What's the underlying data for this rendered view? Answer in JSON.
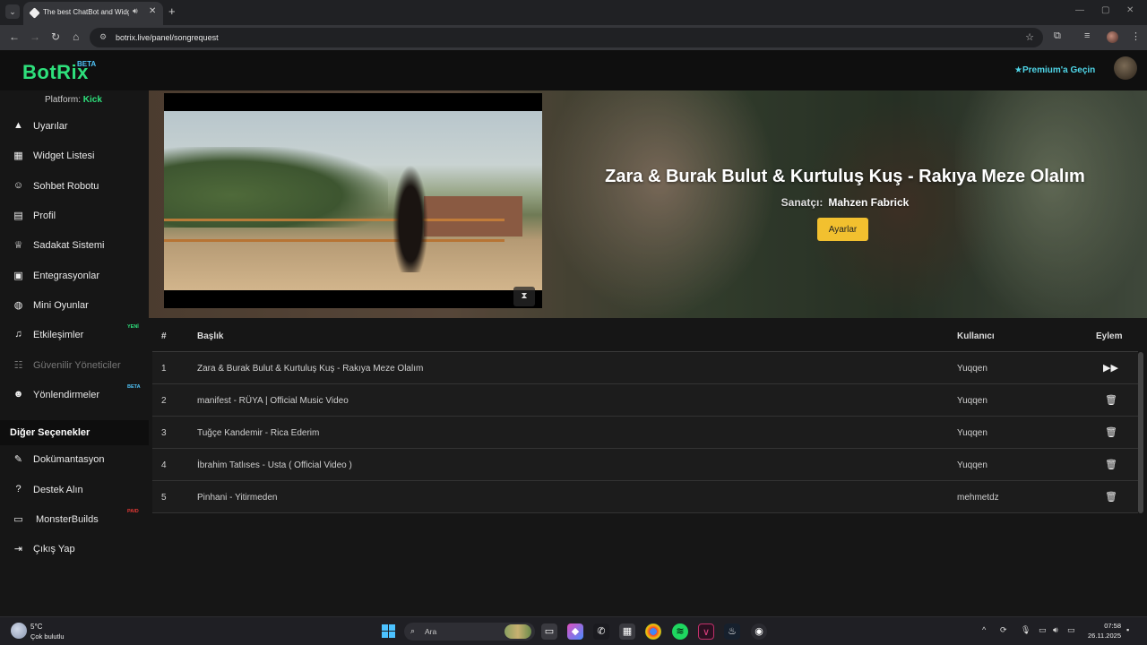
{
  "browser": {
    "tab_title": "The best ChatBot and Widgets",
    "url": "botrix.live/panel/songrequest"
  },
  "header": {
    "logo": "BotRix",
    "logo_badge": "BETA",
    "premium_label": "Premium'a Geçin"
  },
  "sidebar": {
    "platform_label": "Platform:",
    "platform_value": "Kick",
    "items": [
      {
        "label": "Uyarılar",
        "icon": "warning-icon"
      },
      {
        "label": "Widget Listesi",
        "icon": "grid-icon"
      },
      {
        "label": "Sohbet Robotu",
        "icon": "robot-icon"
      },
      {
        "label": "Profil",
        "icon": "id-card-icon"
      },
      {
        "label": "Sadakat Sistemi",
        "icon": "trophy-icon"
      },
      {
        "label": "Entegrasyonlar",
        "icon": "plug-icon"
      },
      {
        "label": "Mini Oyunlar",
        "icon": "gamepad-icon"
      },
      {
        "label": "Etkileşimler",
        "icon": "music-icon",
        "badge": "YENİ",
        "badge_color": "#2ee07c"
      },
      {
        "label": "Güvenilir Yöneticiler",
        "icon": "users-icon",
        "disabled": true
      },
      {
        "label": "Yönlendirmeler",
        "icon": "user-group-icon",
        "badge": "BETA",
        "badge_color": "#4fc3f7"
      }
    ],
    "section_title": "Diğer Seçenekler",
    "other_items": [
      {
        "label": "Dokümantasyon",
        "icon": "scroll-icon"
      },
      {
        "label": "Destek Alın",
        "icon": "question-icon"
      },
      {
        "label": "MonsterBuilds",
        "icon": "laptop-icon",
        "badge": "PAID",
        "badge_color": "#e53935"
      },
      {
        "label": "Çıkış Yap",
        "icon": "logout-icon"
      }
    ]
  },
  "now_playing": {
    "title": "Zara & Burak Bulut & Kurtuluş Kuş - Rakıya Meze Olalım",
    "artist_label": "Sanatçı:",
    "artist": "Mahzen Fabrick",
    "settings_button": "Ayarlar"
  },
  "queue": {
    "columns": [
      "#",
      "Başlık",
      "Kullanıcı",
      "Eylem"
    ],
    "rows": [
      {
        "num": "1",
        "title": "Zara & Burak Bulut & Kurtuluş Kuş - Rakıya Meze Olalım",
        "user": "Yuqqen",
        "action": "skip"
      },
      {
        "num": "2",
        "title": "manifest - RÜYA | Official Music Video",
        "user": "Yuqqen",
        "action": "delete"
      },
      {
        "num": "3",
        "title": "Tuğçe Kandemir - Rica Ederim",
        "user": "Yuqqen",
        "action": "delete"
      },
      {
        "num": "4",
        "title": "İbrahim Tatlıses - Usta ( Official Video )",
        "user": "Yuqqen",
        "action": "delete"
      },
      {
        "num": "5",
        "title": "Pinhani - Yitirmeden",
        "user": "mehmetdz",
        "action": "delete"
      }
    ]
  },
  "taskbar": {
    "weather_temp": "5°C",
    "weather_desc": "Çok bulutlu",
    "search_placeholder": "Ara",
    "time": "07:58",
    "date": "26.11.2025"
  },
  "colors": {
    "accent_green": "#2ee07c",
    "premium_cyan": "#4fd6e8",
    "settings_yellow": "#f2c02f"
  }
}
